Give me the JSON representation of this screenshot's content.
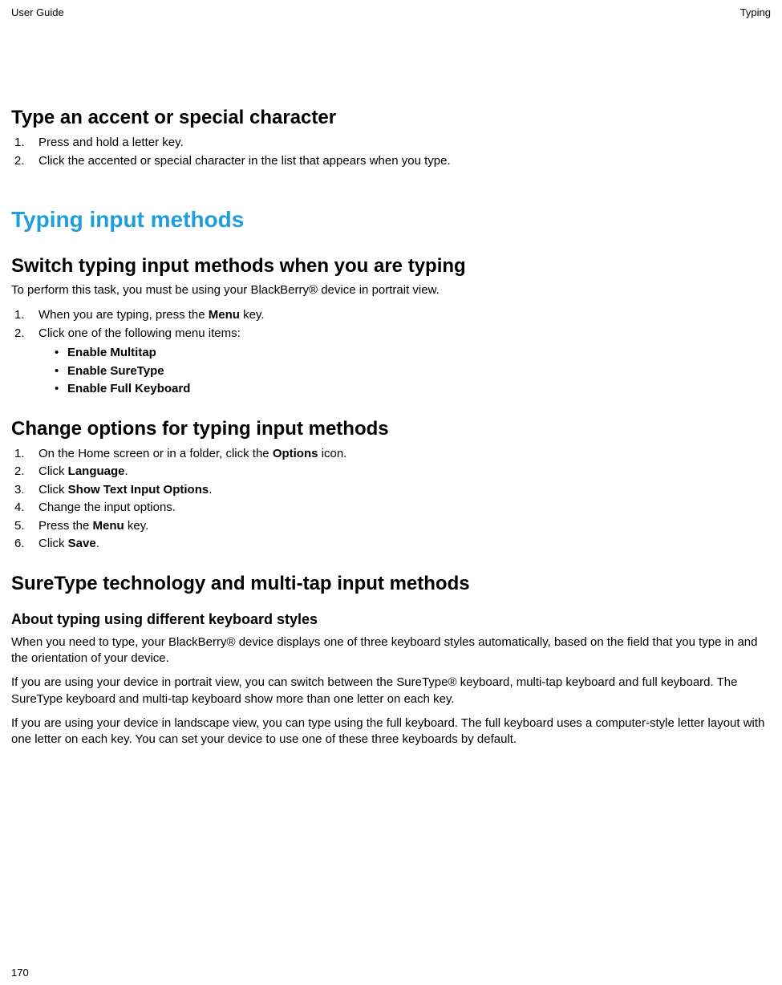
{
  "header": {
    "left": "User Guide",
    "right": "Typing"
  },
  "section1": {
    "title": "Type an accent or special character",
    "steps": [
      "Press and hold a letter key.",
      "Click the accented or special character in the list that appears when you type."
    ]
  },
  "bigTitle": "Typing input methods",
  "section2": {
    "title": "Switch typing input methods when you are typing",
    "intro": "To perform this task, you must be using your BlackBerry® device in portrait view.",
    "step1_a": "When you are typing, press the ",
    "step1_bold": "Menu",
    "step1_b": " key.",
    "step2": "Click one of the following menu items:",
    "bullets": [
      "Enable Multitap",
      "Enable SureType",
      "Enable Full Keyboard"
    ]
  },
  "section3": {
    "title": "Change options for typing input methods",
    "step1_a": "On the Home screen or in a folder, click the ",
    "step1_bold": "Options",
    "step1_b": " icon.",
    "step2_a": "Click ",
    "step2_bold": "Language",
    "step2_b": ".",
    "step3_a": "Click ",
    "step3_bold": "Show Text Input Options",
    "step3_b": ".",
    "step4": "Change the input options.",
    "step5_a": "Press the ",
    "step5_bold": "Menu",
    "step5_b": " key.",
    "step6_a": "Click ",
    "step6_bold": "Save",
    "step6_b": "."
  },
  "section4": {
    "title": "SureType technology and multi-tap input methods",
    "sub": "About typing using different keyboard styles",
    "p1": "When you need to type, your BlackBerry® device displays one of three keyboard styles automatically, based on the field that you type in and the orientation of your device.",
    "p2": "If you are using your device in portrait view, you can switch between the SureType® keyboard, multi-tap keyboard and full keyboard. The SureType keyboard and multi-tap keyboard show more than one letter on each key.",
    "p3": "If you are using your device in landscape view, you can type using the full keyboard. The full keyboard uses a computer-style letter layout with one letter on each key. You can set your device to use one of these three keyboards by default."
  },
  "pageNumber": "170"
}
